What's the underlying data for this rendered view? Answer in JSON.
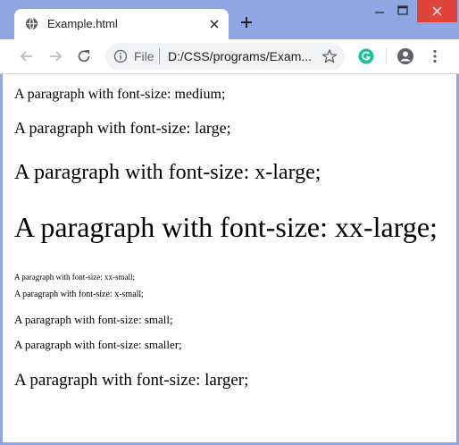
{
  "browser": {
    "tab": {
      "title": "Example.html",
      "favicon_icon": "globe-icon",
      "close_icon": "close-icon"
    },
    "new_tab_icon": "plus-icon",
    "window_controls": {
      "minimize_icon": "minimize-icon",
      "maximize_icon": "maximize-icon",
      "close_icon": "window-close-icon",
      "close_color": "#e0433c"
    },
    "toolbar": {
      "back_icon": "back-arrow-icon",
      "forward_icon": "forward-arrow-icon",
      "reload_icon": "reload-icon",
      "info_icon": "info-icon",
      "scheme_label": "File",
      "url": "D:/CSS/programs/Exam...",
      "bookmark_icon": "star-icon",
      "extension_icon": "grammarly-icon",
      "extension_color": "#15c39a",
      "profile_icon": "account-icon",
      "menu_icon": "more-vert-icon"
    },
    "frame_color": "#8fa6e3"
  },
  "page": {
    "paragraphs": [
      {
        "size": "medium",
        "text": "A paragraph with font-size: medium;"
      },
      {
        "size": "large",
        "text": "A paragraph with font-size: large;"
      },
      {
        "size": "x-large",
        "text": "A paragraph with font-size: x-large;"
      },
      {
        "size": "xx-large",
        "text": "A paragraph with font-size: xx-large;"
      },
      {
        "size": "xx-small",
        "text": "A paragraph with font-size: xx-small;"
      },
      {
        "size": "x-small",
        "text": "A paragraph with font-size: x-small;"
      },
      {
        "size": "small",
        "text": "A paragraph with font-size: small;"
      },
      {
        "size": "smaller",
        "text": "A paragraph with font-size: smaller;"
      },
      {
        "size": "larger",
        "text": "A paragraph with font-size: larger;"
      }
    ]
  }
}
